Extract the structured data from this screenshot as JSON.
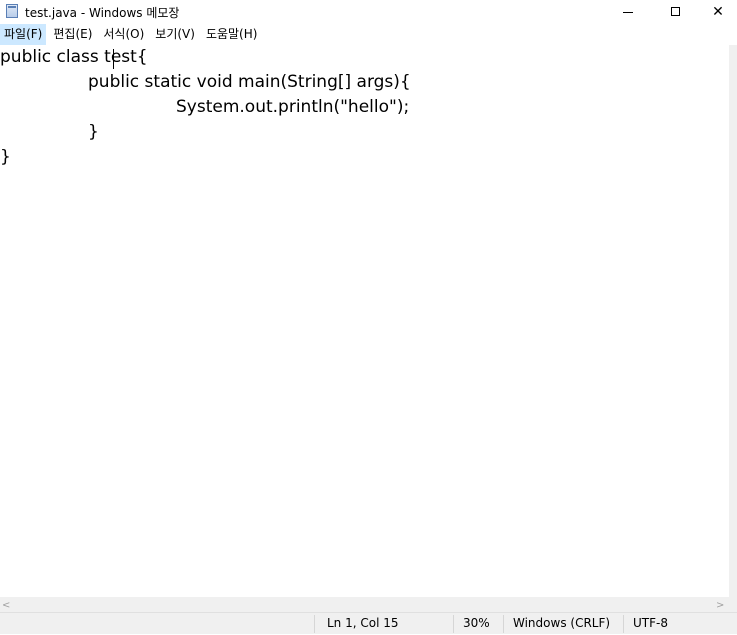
{
  "window": {
    "title": "test.java - Windows 메모장",
    "min_glyph": "",
    "close_glyph": "✕"
  },
  "menu": {
    "items": [
      "파일(F)",
      "편집(E)",
      "서식(O)",
      "보기(V)",
      "도움말(H)"
    ]
  },
  "editor": {
    "lines": [
      "public class test{",
      "\t\tpublic static void main(String[] args){",
      "\t\t\t\tSystem.out.println(\"hello\");",
      "\t\t}",
      "}"
    ],
    "caret": {
      "line": 1,
      "column": 15
    }
  },
  "scroll": {
    "left_arrow": "<",
    "right_arrow": ">"
  },
  "status": {
    "position": "Ln 1, Col 15",
    "zoom": "30%",
    "line_ending": "Windows (CRLF)",
    "encoding": "UTF-8"
  }
}
